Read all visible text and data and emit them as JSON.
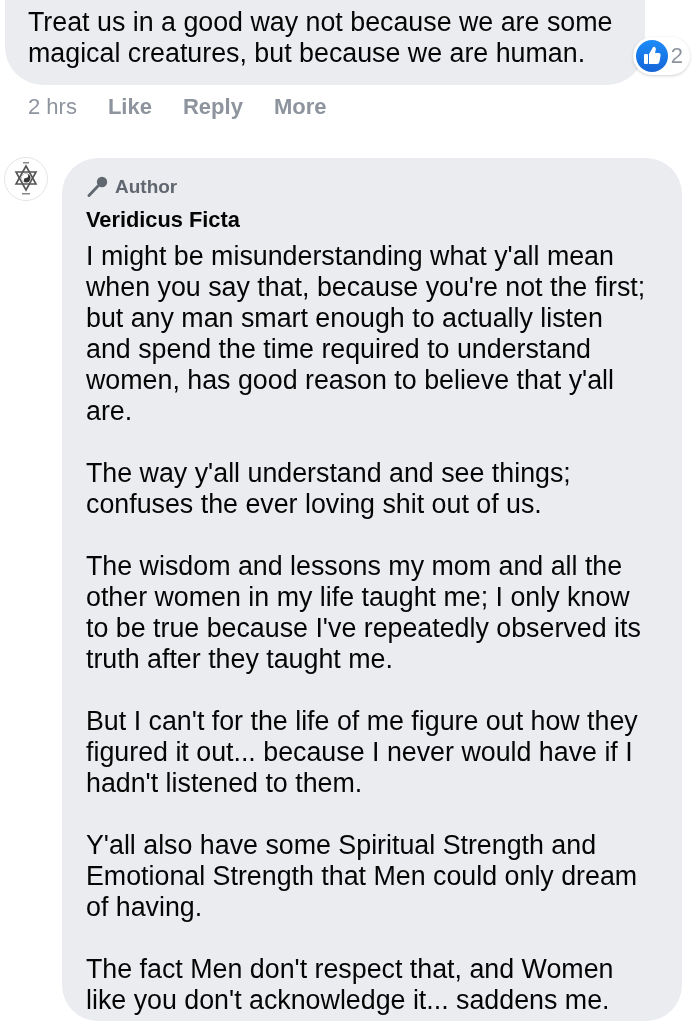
{
  "first_comment": {
    "body": "Treat us in a good way not because we are some magical creatures, but because we are human.",
    "reaction_count": "2",
    "time": "2 hrs",
    "actions": [
      "Like",
      "Reply",
      "More"
    ]
  },
  "reply": {
    "badge": "Author",
    "name": "Veridicus Ficta",
    "paragraphs": [
      "I might be misunderstanding what y'all mean when you say that, because you're not the first; but any man smart enough to actually listen and spend the time required to understand women, has good reason to believe that y'all are.",
      "The way y'all understand and see things; confuses the ever loving shit out of us.",
      "The wisdom and lessons my mom and all the other women in my life taught me; I only know to be true because I've repeatedly observed its truth after they taught me.",
      "But I can't for the life of me figure out how they figured it out... because I never would have if I hadn't listened to them.",
      "Y'all also have some Spiritual Strength and Emotional Strength that Men could only dream of having.",
      "The fact Men don't respect that, and Women like you don't acknowledge it... saddens me."
    ]
  }
}
